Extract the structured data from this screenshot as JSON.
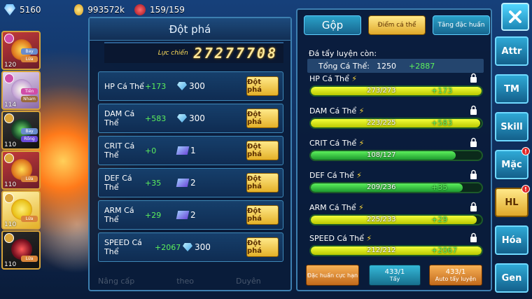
{
  "topbar": {
    "gold": "5160",
    "coins": "993572k",
    "stamina": "159/159"
  },
  "team": [
    {
      "level": "120",
      "tag1": "Bay",
      "tag2": "Lửa"
    },
    {
      "level": "114",
      "tag1": "Tiên",
      "tag2": "Nham"
    },
    {
      "level": "110",
      "tag1": "Bay",
      "tag2": "Rồng"
    },
    {
      "level": "110",
      "tag1": "",
      "tag2": "Lửa"
    },
    {
      "level": "110",
      "tag1": "",
      "tag2": "Lửa"
    },
    {
      "level": "110",
      "tag1": "",
      "tag2": "Lửa"
    }
  ],
  "breakthrough": {
    "title": "Đột phá",
    "power_label": "Lực chiến",
    "power_value": "27277708",
    "rows": [
      {
        "name": "HP Cá Thể",
        "bonus": "+173",
        "cost": "300",
        "cost_icon": "gem-icon",
        "button": "Đột phá"
      },
      {
        "name": "DAM Cá Thể",
        "bonus": "+583",
        "cost": "300",
        "cost_icon": "gem-icon",
        "button": "Đột phá"
      },
      {
        "name": "CRIT Cá Thể",
        "bonus": "+0",
        "cost": "1",
        "cost_icon": "scroll-icon",
        "button": "Đột phá"
      },
      {
        "name": "DEF Cá Thể",
        "bonus": "+35",
        "cost": "2",
        "cost_icon": "scroll-icon",
        "button": "Đột phá"
      },
      {
        "name": "ARM Cá Thể",
        "bonus": "+29",
        "cost": "2",
        "cost_icon": "scroll-icon",
        "button": "Đột phá"
      },
      {
        "name": "SPEED Cá Thể",
        "bonus": "+2067",
        "cost": "300",
        "cost_icon": "gem-icon",
        "button": "Đột phá"
      }
    ],
    "faded_footer": [
      "Nâng cấp",
      "theo",
      "Duyên"
    ]
  },
  "training": {
    "tabs": [
      "Gộp",
      "Điểm cá thể",
      "Tăng đặc huấn"
    ],
    "remaining_label": "Đá tẩy luyện còn:",
    "total_label": "Tổng Cá Thể:",
    "total_value": "1250",
    "total_bonus": "+2887",
    "stats": [
      {
        "name": "HP Cá Thể",
        "value": "273/273",
        "bonus": "+173",
        "fill": 1.0,
        "color": "#f3ff3a"
      },
      {
        "name": "DAM Cá Thể",
        "value": "223/225",
        "bonus": "+583",
        "fill": 0.99,
        "color": "#f3ff3a"
      },
      {
        "name": "CRIT Cá Thể",
        "value": "108/127",
        "bonus": "",
        "fill": 0.85,
        "color": "#5cf05c"
      },
      {
        "name": "DEF Cá Thể",
        "value": "209/236",
        "bonus": "+35",
        "fill": 0.89,
        "color": "#5cf05c"
      },
      {
        "name": "ARM Cá Thể",
        "value": "225/233",
        "bonus": "+29",
        "fill": 0.97,
        "color": "#f3ff3a"
      },
      {
        "name": "SPEED Cá Thể",
        "value": "212/212",
        "bonus": "+2067",
        "fill": 1.0,
        "color": "#f3ff3a"
      }
    ],
    "buttons": [
      {
        "label": "Đặc huấn cực hạn",
        "count": ""
      },
      {
        "label": "Tẩy",
        "count": "433/1"
      },
      {
        "label": "Auto tẩy luyện",
        "count": "433/1"
      }
    ]
  },
  "sidenav": [
    {
      "label": "Attr",
      "alert": false
    },
    {
      "label": "TM",
      "alert": false
    },
    {
      "label": "Skill",
      "alert": false
    },
    {
      "label": "Mặc",
      "alert": true
    },
    {
      "label": "HL",
      "alert": true
    },
    {
      "label": "Hóa",
      "alert": false
    },
    {
      "label": "Gen",
      "alert": false
    }
  ]
}
